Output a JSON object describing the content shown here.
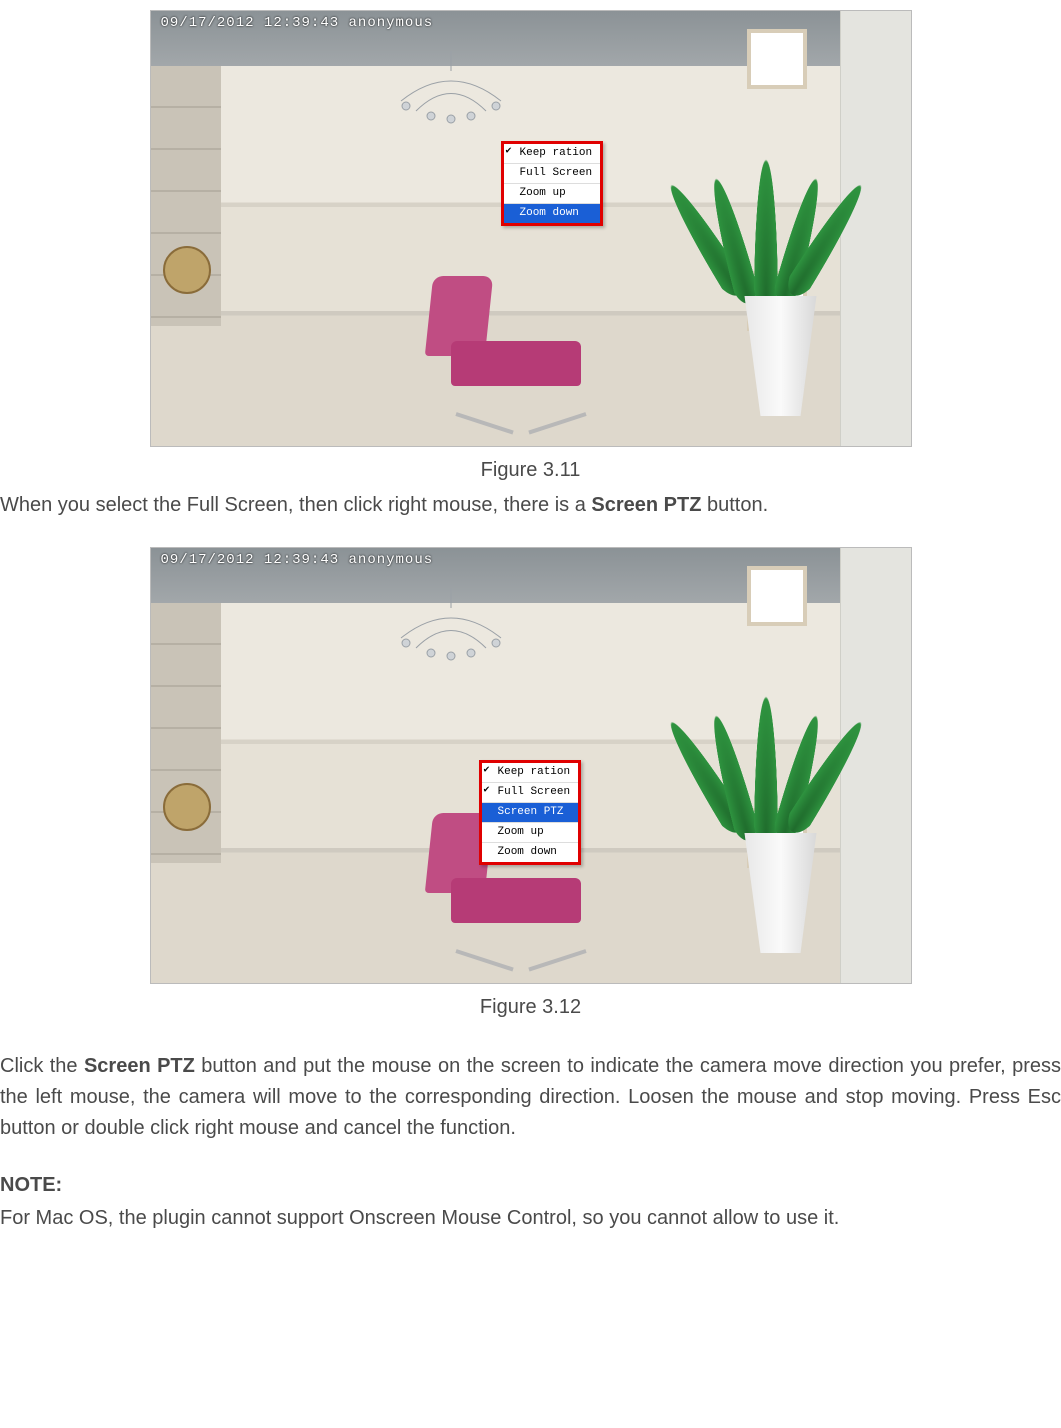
{
  "overlay_text": "09/17/2012 12:39:43 anonymous",
  "figure1": {
    "caption": "Figure 3.11",
    "menu": [
      {
        "label": "Keep ration",
        "checked": true,
        "selected": false
      },
      {
        "label": "Full Screen",
        "checked": false,
        "selected": false
      },
      {
        "label": "Zoom up",
        "checked": false,
        "selected": false
      },
      {
        "label": "Zoom down",
        "checked": false,
        "selected": true
      }
    ]
  },
  "para_after_fig1_pre": "When you select the Full Screen, then click right mouse, there is a ",
  "para_after_fig1_bold": "Screen PTZ",
  "para_after_fig1_post": " button.",
  "figure2": {
    "caption": "Figure 3.12",
    "menu": [
      {
        "label": "Keep ration",
        "checked": true,
        "selected": false
      },
      {
        "label": "Full Screen",
        "checked": true,
        "selected": false
      },
      {
        "label": "Screen PTZ",
        "checked": false,
        "selected": true
      },
      {
        "label": "Zoom up",
        "checked": false,
        "selected": false
      },
      {
        "label": "Zoom down",
        "checked": false,
        "selected": false
      }
    ]
  },
  "para_after_fig2_pre": "Click the ",
  "para_after_fig2_bold": "Screen PTZ",
  "para_after_fig2_post": " button and put the mouse on the screen to indicate the camera move direction you prefer, press the left mouse, the camera will move to the corresponding direction. Loosen the mouse and stop moving. Press Esc button or double click right mouse and cancel the function.",
  "note_heading": "NOTE:",
  "note_body": "For Mac OS, the plugin cannot support Onscreen Mouse Control, so you cannot allow to use it."
}
